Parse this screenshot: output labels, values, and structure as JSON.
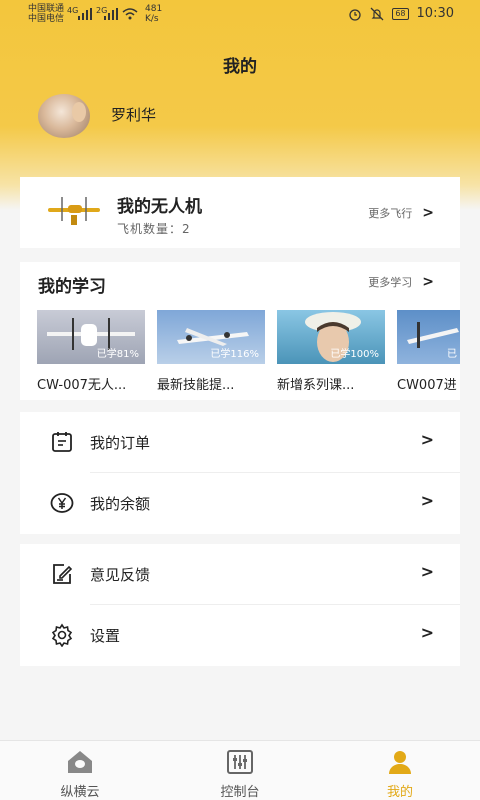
{
  "status_bar": {
    "carrier1": "中国联通",
    "carrier2": "中国电信",
    "net1": "4G",
    "net2": "2G",
    "speed": "481 K/s",
    "battery": "68",
    "time": "10:30"
  },
  "header": {
    "title": "我的"
  },
  "user": {
    "name": "罗利华"
  },
  "drone": {
    "title": "我的无人机",
    "count_label": "飞机数量：2",
    "more_label": "更多飞行"
  },
  "learning": {
    "title": "我的学习",
    "more_label": "更多学习",
    "courses": [
      {
        "name": "CW-007无人...",
        "progress": "已学81%"
      },
      {
        "name": "最新技能提...",
        "progress": "已学116%"
      },
      {
        "name": "新增系列课...",
        "progress": "已学100%"
      },
      {
        "name": "CW007进",
        "progress": "已"
      }
    ]
  },
  "menu": {
    "orders": "我的订单",
    "balance": "我的余额",
    "feedback": "意见反馈",
    "settings": "设置"
  },
  "nav": {
    "home": "纵横云",
    "console": "控制台",
    "mine": "我的",
    "active_color": "#e2a917"
  }
}
